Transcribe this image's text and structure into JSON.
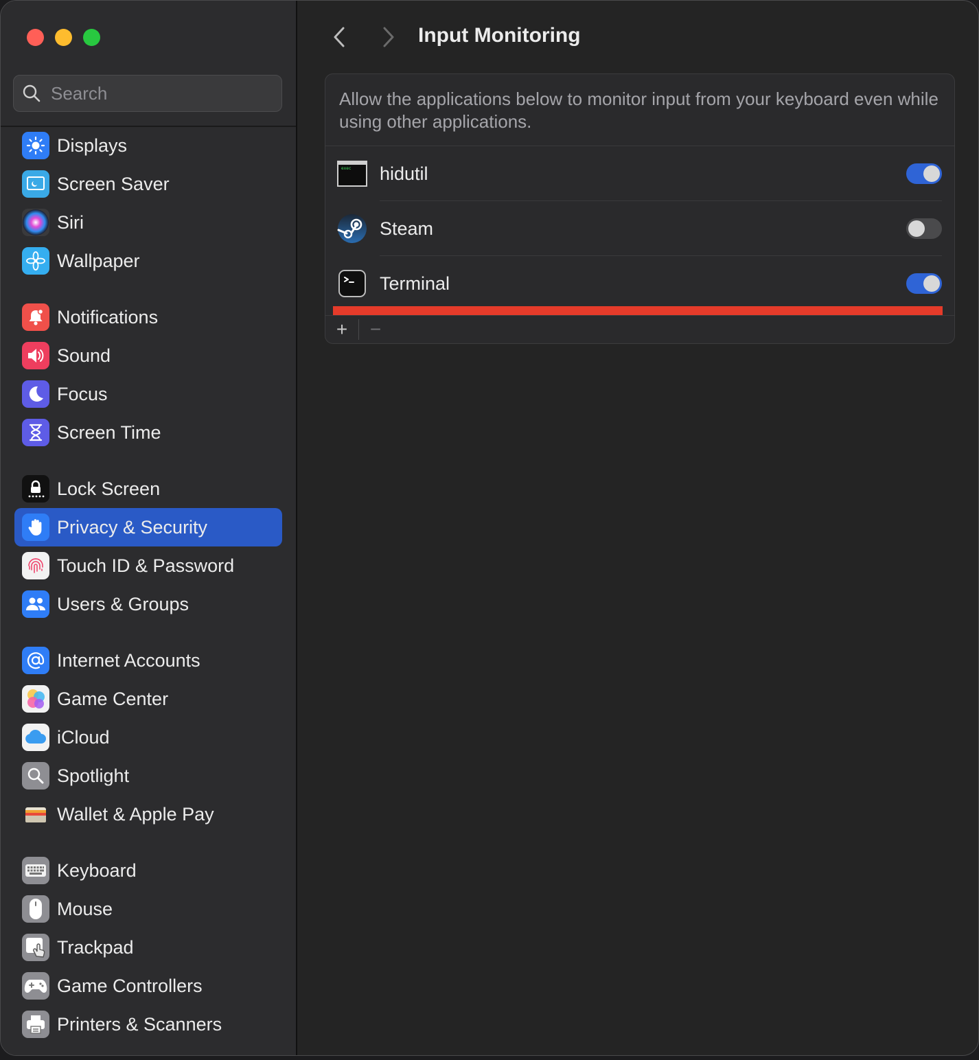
{
  "window": {
    "traffic_lights": {
      "close": "#ff5f57",
      "minimize": "#febc2e",
      "zoom": "#28c840"
    }
  },
  "search": {
    "placeholder": "Search",
    "value": ""
  },
  "sidebar": {
    "selected_color": "#2a5ac6",
    "groups": [
      [
        {
          "id": "displays",
          "label": "Displays",
          "icon": "sun-icon",
          "color": "#2f7df6"
        },
        {
          "id": "screen-saver",
          "label": "Screen Saver",
          "icon": "screen-saver-icon",
          "color": "#3aa9e6"
        },
        {
          "id": "siri",
          "label": "Siri",
          "icon": "siri-icon",
          "color": "#3a3a3c"
        },
        {
          "id": "wallpaper",
          "label": "Wallpaper",
          "icon": "flower-icon",
          "color": "#35aef0"
        }
      ],
      [
        {
          "id": "notifications",
          "label": "Notifications",
          "icon": "bell-icon",
          "color": "#f0504a"
        },
        {
          "id": "sound",
          "label": "Sound",
          "icon": "speaker-icon",
          "color": "#ee3e5e"
        },
        {
          "id": "focus",
          "label": "Focus",
          "icon": "moon-icon",
          "color": "#5e5ce6"
        },
        {
          "id": "screen-time",
          "label": "Screen Time",
          "icon": "hourglass-icon",
          "color": "#5e5ce6"
        }
      ],
      [
        {
          "id": "lock-screen",
          "label": "Lock Screen",
          "icon": "lock-icon",
          "color": "#111111"
        },
        {
          "id": "privacy-security",
          "label": "Privacy & Security",
          "icon": "hand-icon",
          "color": "#2f7df6",
          "selected": true
        },
        {
          "id": "touch-id",
          "label": "Touch ID & Password",
          "icon": "fingerprint-icon",
          "color": "#f2f2f2"
        },
        {
          "id": "users-groups",
          "label": "Users & Groups",
          "icon": "users-icon",
          "color": "#2f7df6"
        }
      ],
      [
        {
          "id": "internet-accounts",
          "label": "Internet Accounts",
          "icon": "at-icon",
          "color": "#2f7df6"
        },
        {
          "id": "game-center",
          "label": "Game Center",
          "icon": "game-center-icon",
          "color": "#f2f2f2"
        },
        {
          "id": "icloud",
          "label": "iCloud",
          "icon": "cloud-icon",
          "color": "#f2f2f2"
        },
        {
          "id": "spotlight",
          "label": "Spotlight",
          "icon": "magnifier-icon",
          "color": "#8e8e93"
        },
        {
          "id": "wallet",
          "label": "Wallet & Apple Pay",
          "icon": "wallet-icon",
          "color": "#2c2c2e"
        }
      ],
      [
        {
          "id": "keyboard",
          "label": "Keyboard",
          "icon": "keyboard-icon",
          "color": "#8e8e93"
        },
        {
          "id": "mouse",
          "label": "Mouse",
          "icon": "mouse-icon",
          "color": "#8e8e93"
        },
        {
          "id": "trackpad",
          "label": "Trackpad",
          "icon": "trackpad-icon",
          "color": "#8e8e93"
        },
        {
          "id": "game-controllers",
          "label": "Game Controllers",
          "icon": "gamepad-icon",
          "color": "#8e8e93"
        },
        {
          "id": "printers",
          "label": "Printers & Scanners",
          "icon": "printer-icon",
          "color": "#8e8e93"
        }
      ]
    ]
  },
  "main": {
    "title": "Input Monitoring",
    "description": "Allow the applications below to monitor input from your keyboard even while using other applications.",
    "apps": [
      {
        "name": "hidutil",
        "icon": "exec-icon",
        "enabled": true
      },
      {
        "name": "Steam",
        "icon": "steam-icon",
        "enabled": false
      },
      {
        "name": "Terminal",
        "icon": "terminal-icon",
        "enabled": true
      }
    ],
    "highlight_color": "#e53b2a",
    "footer": {
      "add": "+",
      "remove": "−"
    }
  }
}
